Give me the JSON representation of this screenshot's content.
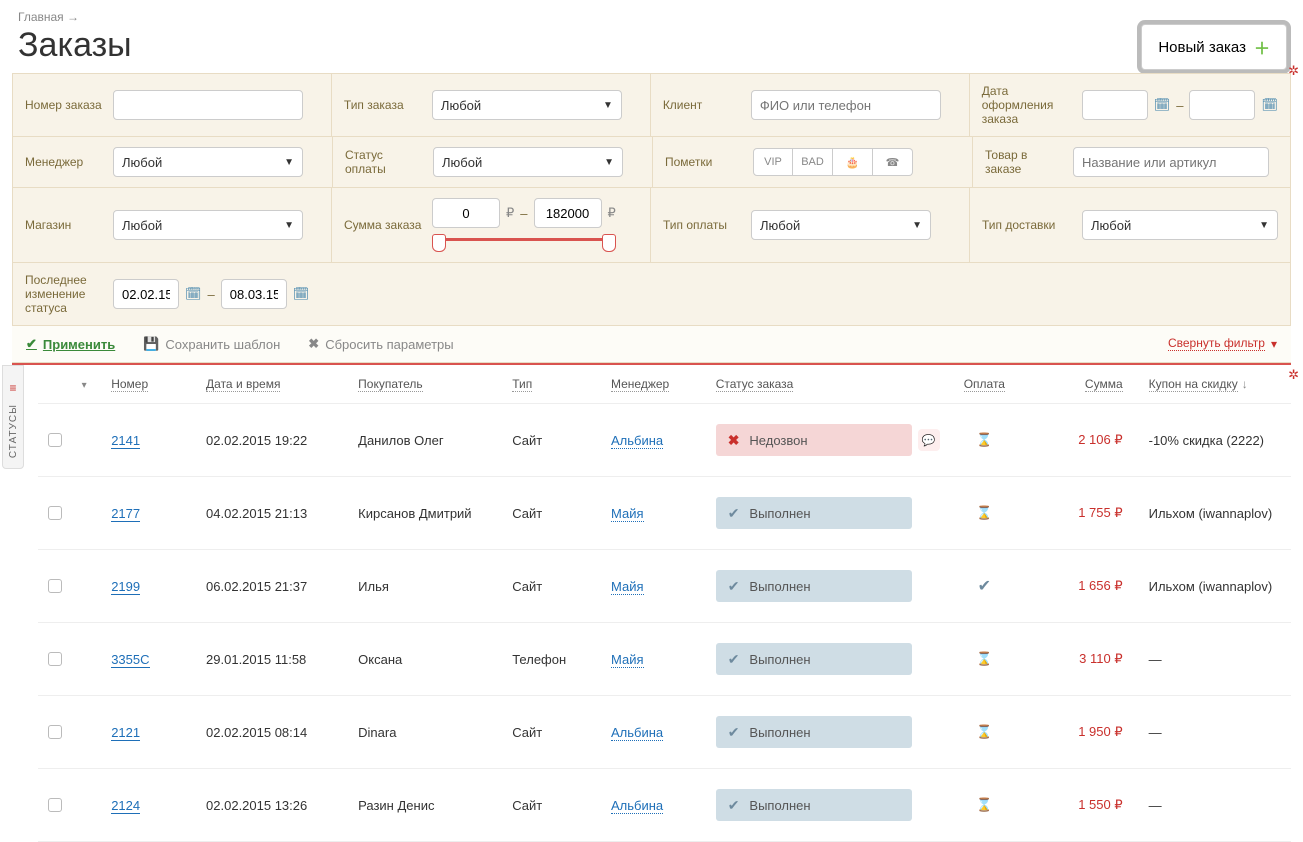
{
  "breadcrumb": {
    "home": "Главная",
    "arrow": "→"
  },
  "page_title": "Заказы",
  "new_order_btn": "Новый заказ",
  "filters": {
    "order_number": "Номер заказа",
    "order_type": "Тип заказа",
    "any": "Любой",
    "client": "Клиент",
    "client_ph": "ФИО или телефон",
    "order_date": "Дата оформления заказа",
    "manager": "Менеджер",
    "payment_status": "Статус оплаты",
    "tags": "Пометки",
    "tag_vip": "VIP",
    "tag_bad": "BAD",
    "product": "Товар в заказе",
    "product_ph": "Название или артикул",
    "shop": "Магазин",
    "order_sum": "Сумма заказа",
    "sum_from": "0",
    "sum_to": "182000",
    "payment_type": "Тип оплаты",
    "delivery_type": "Тип доставки",
    "last_status_change": "Последнее изменение статуса",
    "date_from": "02.02.15",
    "date_to": "08.03.15"
  },
  "actions": {
    "apply": "Применить",
    "save": "Сохранить шаблон",
    "reset": "Сбросить параметры",
    "collapse": "Свернуть фильтр"
  },
  "side_tab": "СТАТУСЫ",
  "columns": {
    "number": "Номер",
    "datetime": "Дата и время",
    "buyer": "Покупатель",
    "type": "Тип",
    "manager": "Менеджер",
    "order_status": "Статус заказа",
    "payment": "Оплата",
    "sum": "Сумма",
    "coupon": "Купон на скидку"
  },
  "rows": [
    {
      "num": "2141",
      "dt": "02.02.2015 19:22",
      "buyer": "Данилов Олег",
      "type": "Сайт",
      "mgr": "Альбина",
      "status": "Недозвон",
      "status_kind": "fail",
      "bubble": true,
      "pay": "hourglass",
      "sum": "2 106 ₽",
      "coupon": "-10% скидка (2222)"
    },
    {
      "num": "2177",
      "dt": "04.02.2015 21:13",
      "buyer": "Кирсанов Дмитрий",
      "type": "Сайт",
      "mgr": "Майя",
      "status": "Выполнен",
      "status_kind": "done",
      "bubble": false,
      "pay": "hourglass",
      "sum": "1 755 ₽",
      "coupon": "Ильхом (iwannaplov)"
    },
    {
      "num": "2199",
      "dt": "06.02.2015 21:37",
      "buyer": "Илья",
      "type": "Сайт",
      "mgr": "Майя",
      "status": "Выполнен",
      "status_kind": "done",
      "bubble": false,
      "pay": "check",
      "sum": "1 656 ₽",
      "coupon": "Ильхом (iwannaplov)"
    },
    {
      "num": "3355C",
      "dt": "29.01.2015 11:58",
      "buyer": "Оксана",
      "type": "Телефон",
      "mgr": "Майя",
      "status": "Выполнен",
      "status_kind": "done",
      "bubble": false,
      "pay": "hourglass",
      "sum": "3 110 ₽",
      "coupon": "—"
    },
    {
      "num": "2121",
      "dt": "02.02.2015 08:14",
      "buyer": "Dinara",
      "type": "Сайт",
      "mgr": "Альбина",
      "status": "Выполнен",
      "status_kind": "done",
      "bubble": false,
      "pay": "hourglass",
      "sum": "1 950 ₽",
      "coupon": "—"
    },
    {
      "num": "2124",
      "dt": "02.02.2015 13:26",
      "buyer": "Разин Денис",
      "type": "Сайт",
      "mgr": "Альбина",
      "status": "Выполнен",
      "status_kind": "done",
      "bubble": false,
      "pay": "hourglass",
      "sum": "1 550 ₽",
      "coupon": "—"
    }
  ]
}
